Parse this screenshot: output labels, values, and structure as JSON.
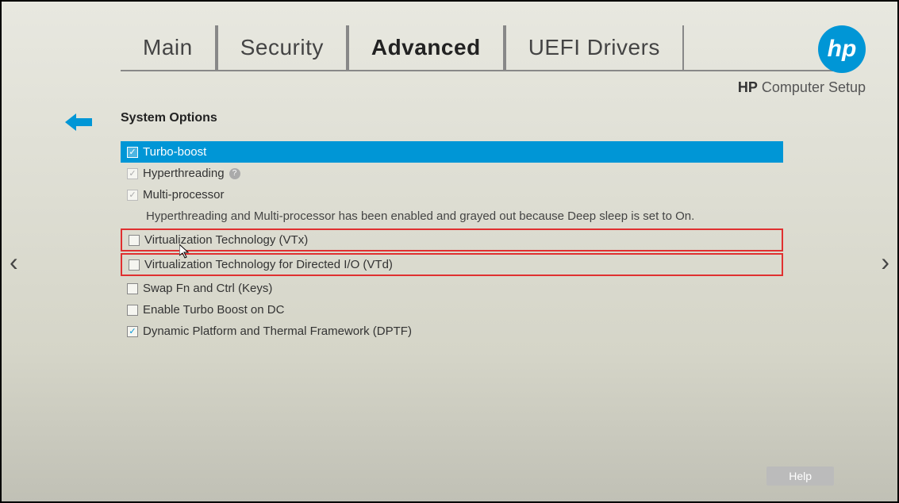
{
  "brand": {
    "logo_text": "hp",
    "label_prefix": "HP",
    "label_suffix": "Computer Setup"
  },
  "tabs": {
    "main": "Main",
    "security": "Security",
    "advanced": "Advanced",
    "uefi": "UEFI Drivers",
    "active": "advanced"
  },
  "section": {
    "title": "System Options",
    "info_text": "Hyperthreading and Multi-processor has been enabled and grayed out because Deep sleep is set to On."
  },
  "options": {
    "turbo_boost": {
      "label": "Turbo-boost",
      "checked": true,
      "selected": true
    },
    "hyperthreading": {
      "label": "Hyperthreading",
      "checked": true,
      "grayed": true,
      "help": true
    },
    "multi_processor": {
      "label": "Multi-processor",
      "checked": true,
      "grayed": true
    },
    "vtx": {
      "label": "Virtualization Technology (VTx)",
      "checked": false,
      "highlighted": true
    },
    "vtd": {
      "label": "Virtualization Technology for Directed I/O (VTd)",
      "checked": false,
      "highlighted": true
    },
    "swap_fn": {
      "label": "Swap Fn and Ctrl (Keys)",
      "checked": false
    },
    "turbo_dc": {
      "label": "Enable Turbo Boost on DC",
      "checked": false
    },
    "dptf": {
      "label": "Dynamic Platform and Thermal Framework (DPTF)",
      "checked": true
    }
  },
  "footer": {
    "help": "Help"
  }
}
